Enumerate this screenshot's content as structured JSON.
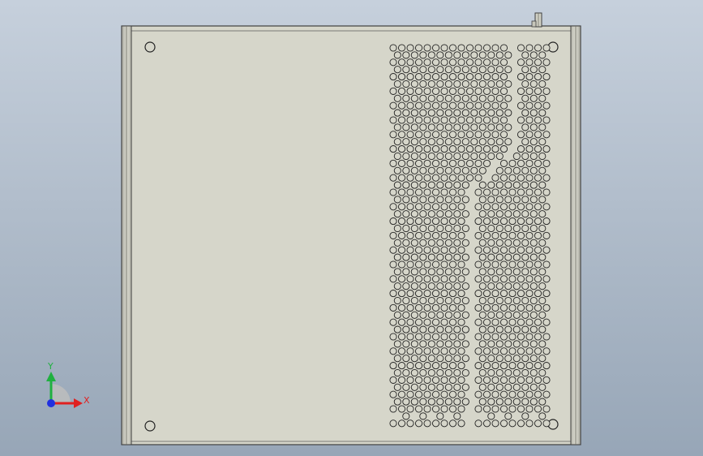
{
  "viewport": {
    "background_top": "#c6d0dc",
    "background_bottom": "#97a6b7"
  },
  "part": {
    "panel_face_color": "#d6d6ca",
    "panel_edge_color": "#4a4a4a",
    "flange_color": "#c7c7bb",
    "hole_color": "#222222"
  },
  "triad": {
    "x_label": "X",
    "y_label": "Y",
    "x_color": "#e02020",
    "y_color": "#20b040",
    "z_color": "#2030e0",
    "x_icon": "x-axis-arrow-icon",
    "y_icon": "y-axis-arrow-icon",
    "origin_icon": "z-axis-origin-icon"
  }
}
